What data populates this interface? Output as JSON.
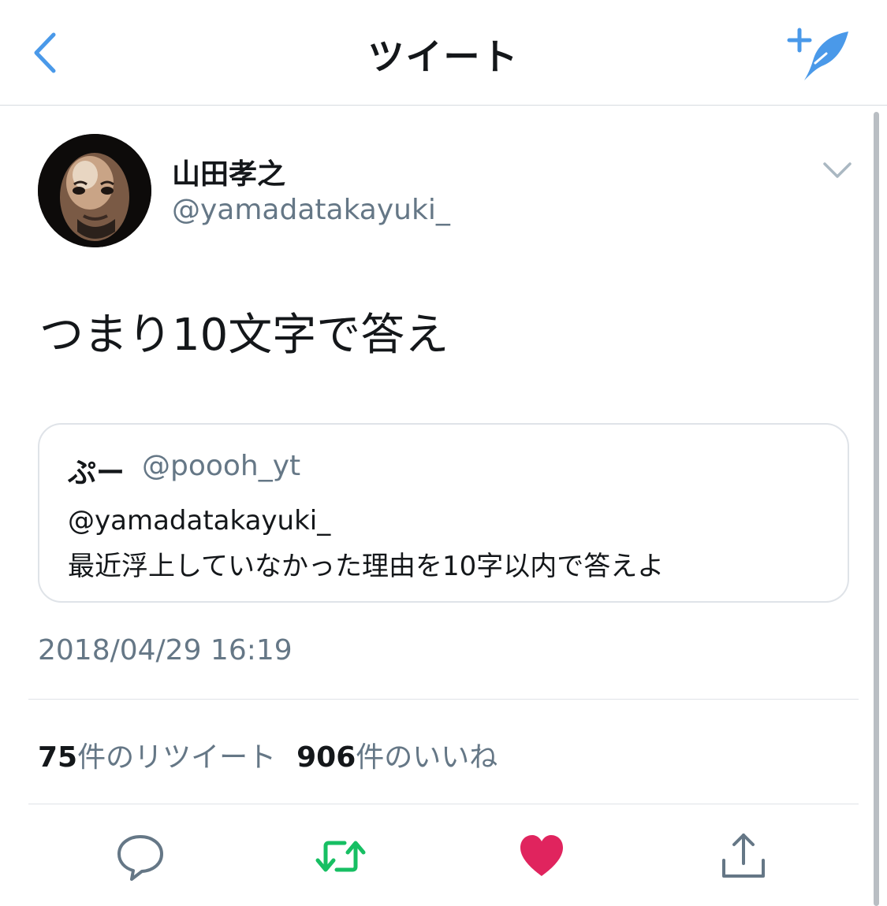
{
  "nav": {
    "title": "ツイート"
  },
  "tweet": {
    "author_name": "山田孝之",
    "author_handle": "@yamadatakayuki_",
    "text": "つまり10文字で答え",
    "timestamp": "2018/04/29 16:19"
  },
  "quote": {
    "name": "ぷー",
    "handle": "@poooh_yt",
    "line1": "@yamadatakayuki_",
    "line2": "最近浮上していなかった理由を10字以内で答えよ"
  },
  "stats": {
    "retweets_count": "75",
    "retweets_label": "件のリツイート",
    "likes_count": "906",
    "likes_label": "件のいいね"
  },
  "colors": {
    "accent": "#4a99e9",
    "retweet_green": "#17bf63",
    "like_red": "#e0245e",
    "secondary_text": "#657786",
    "border": "#dfe3e8"
  },
  "icons": {
    "back": "chevron-left-icon",
    "compose": "compose-tweet-icon",
    "menu": "chevron-down-icon",
    "reply": "reply-icon",
    "retweet": "retweet-icon",
    "like": "heart-icon",
    "share": "share-icon"
  }
}
